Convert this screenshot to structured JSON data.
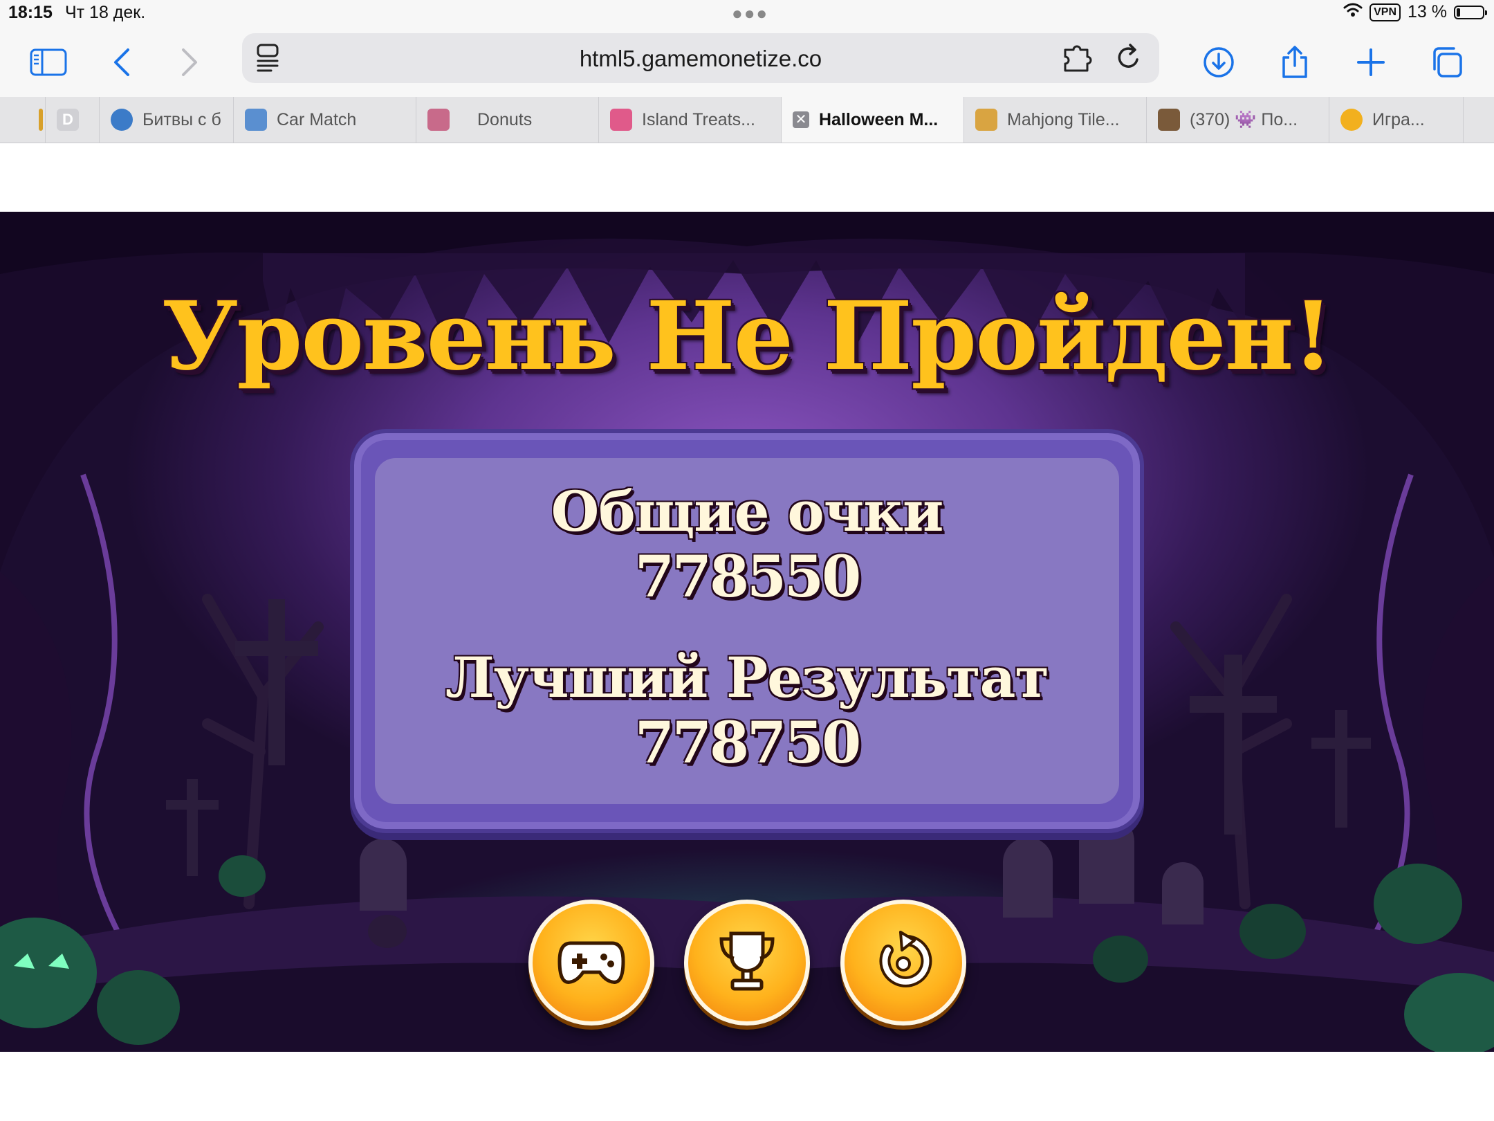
{
  "status_bar": {
    "time": "18:15",
    "date": "Чт 18 дек.",
    "vpn": "VPN",
    "battery": "13 %",
    "battery_fraction": 0.13
  },
  "browser": {
    "url": "html5.gamemonetize.co",
    "icons": [
      "sidebar-icon",
      "back-icon",
      "forward-icon",
      "page-menu-icon",
      "extension-icon",
      "reload-icon",
      "download-icon",
      "share-icon",
      "new-tab-icon",
      "tabs-overview-icon"
    ]
  },
  "tabs": [
    {
      "label": "",
      "favicon_color": "#d8a02a"
    },
    {
      "label": "D",
      "favicon_color": "#c8c8cc"
    },
    {
      "label": "Битвы с б",
      "favicon_color": "#3b7bc8"
    },
    {
      "label": "Car Match",
      "favicon_color": "#5a8fd0"
    },
    {
      "label": "Donuts",
      "favicon_color": "#c86a8a"
    },
    {
      "label": "Island Treats...",
      "favicon_color": "#e05a8a"
    },
    {
      "label": "Halloween M...",
      "active": true
    },
    {
      "label": "Mahjong Tile...",
      "favicon_color": "#d9a441"
    },
    {
      "label": "(370) 👾 По...",
      "favicon_color": "#7a5a3a"
    },
    {
      "label": "Игра...",
      "favicon_color": "#f2b01e"
    }
  ],
  "game": {
    "title": "Уровень Не Пройден!",
    "score_label": "Общие очки",
    "score_value": "778550",
    "best_label": "Лучший Результат",
    "best_value": "778750",
    "buttons": [
      "gamepad-icon",
      "trophy-icon",
      "restart-icon"
    ],
    "accent_color": "#ffc21d"
  }
}
